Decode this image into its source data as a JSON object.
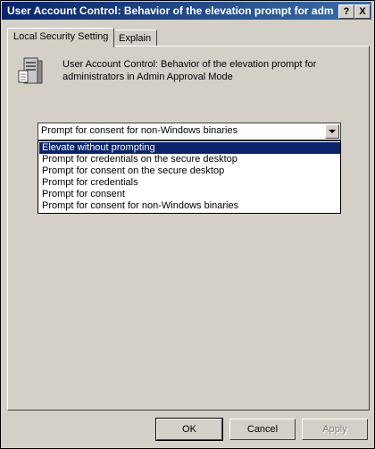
{
  "window": {
    "title": "User Account Control: Behavior of the elevation prompt for admi...",
    "help_button": "?",
    "close_button": "X"
  },
  "tabs": [
    {
      "label": "Local Security Setting",
      "active": true
    },
    {
      "label": "Explain",
      "active": false
    }
  ],
  "policy": {
    "icon": "server-policy-icon",
    "title": "User Account Control: Behavior of the elevation prompt for administrators in Admin Approval Mode"
  },
  "dropdown": {
    "selected_value": "Prompt for consent for non-Windows binaries",
    "options": [
      "Elevate without prompting",
      "Prompt for credentials on the secure desktop",
      "Prompt for consent on the secure desktop",
      "Prompt for credentials",
      "Prompt for consent",
      "Prompt for consent for non-Windows binaries"
    ],
    "highlighted_index": 0
  },
  "buttons": {
    "ok": "OK",
    "cancel": "Cancel",
    "apply": "Apply"
  },
  "colors": {
    "title_bar": "#0a246a",
    "window_face": "#d4d0c8",
    "highlight": "#0a246a"
  }
}
